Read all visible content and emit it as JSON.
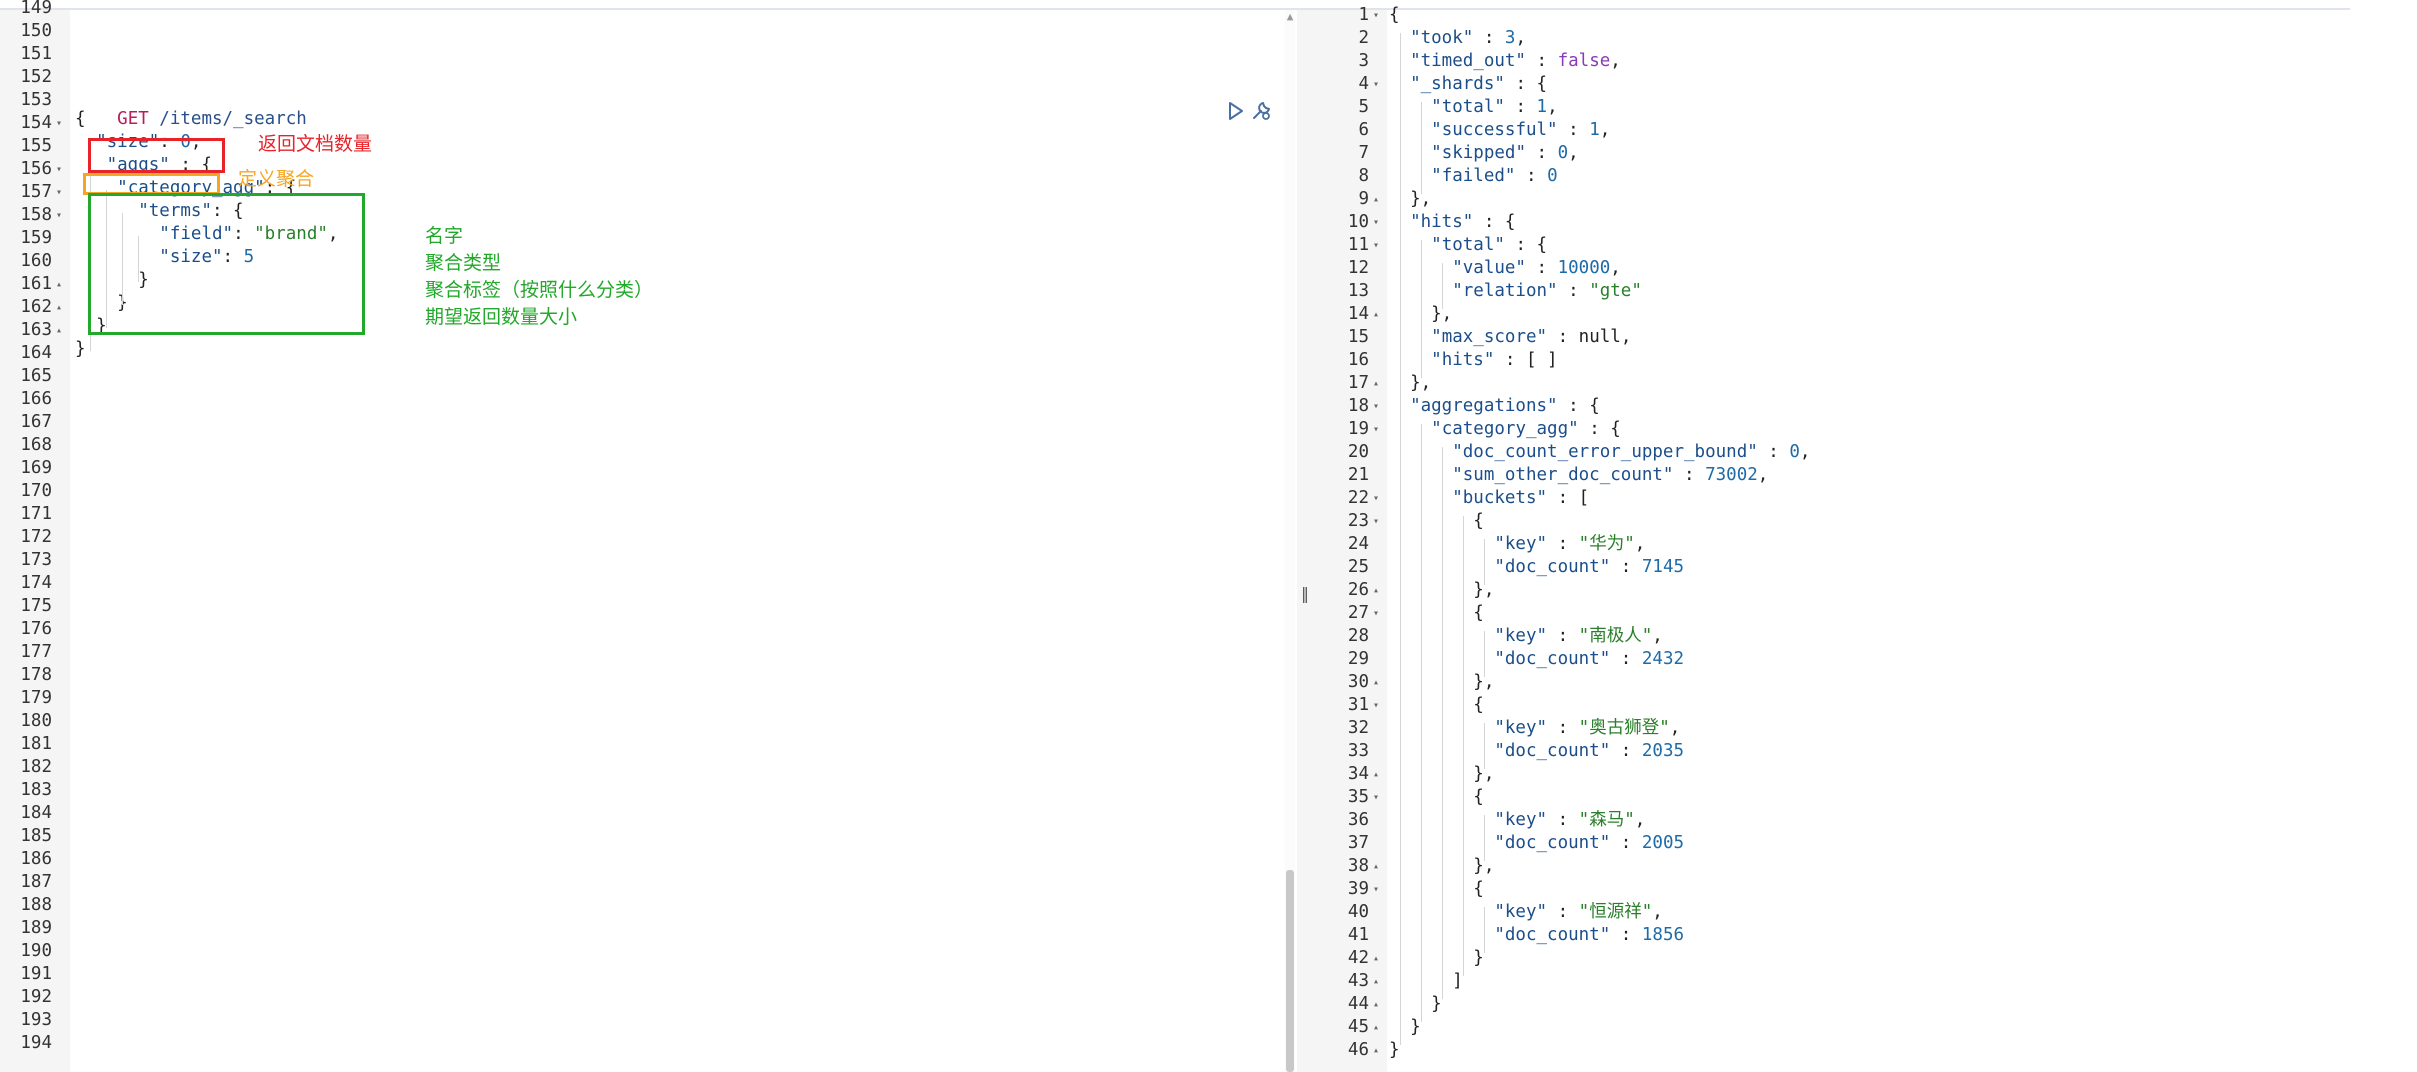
{
  "request_editor": {
    "method": "GET",
    "url": " /items/_search",
    "line_numbers": [
      "149",
      "150",
      "151",
      "152",
      "153",
      "154",
      "155",
      "156",
      "157",
      "158",
      "159",
      "160",
      "161",
      "162",
      "163",
      "164",
      "165",
      "166",
      "167",
      "168",
      "169",
      "170",
      "171",
      "172",
      "173",
      "174",
      "175",
      "176",
      "177",
      "178",
      "179",
      "180",
      "181",
      "182",
      "183",
      "184",
      "185",
      "186",
      "187",
      "188",
      "189",
      "190",
      "191",
      "192",
      "193",
      "194"
    ],
    "code": {
      "l154": "{",
      "l155_key": "\"size\"",
      "l155_rest": ": ",
      "l155_num": "0",
      "l155_end": ",",
      "l156_key": "\"aggs\"",
      "l156_rest": " : {",
      "l157_key": "\"category_agg\"",
      "l157_rest": ": {",
      "l158_key": "\"terms\"",
      "l158_rest": ": {",
      "l159_key": "\"field\"",
      "l159_rest": ": ",
      "l159_val": "\"brand\"",
      "l159_end": ",",
      "l160_key": "\"size\"",
      "l160_rest": ": ",
      "l160_num": "5",
      "l161": "}",
      "l162": "}",
      "l163": "}",
      "l164": "}"
    },
    "annotations": {
      "size_note": "返回文档数量",
      "aggs_note": "定义聚合",
      "name_note": "名字",
      "type_note": "聚合类型",
      "field_note": "聚合标签（按照什么分类）",
      "count_note": "期望返回数量大小"
    },
    "annotation_colors": {
      "red": "#e8232a",
      "orange": "#f5a623",
      "green": "#22a82a"
    },
    "icons": [
      "play-icon",
      "wrench-icon"
    ]
  },
  "response_panel": {
    "line_numbers": [
      "1",
      "2",
      "3",
      "4",
      "5",
      "6",
      "7",
      "8",
      "9",
      "10",
      "11",
      "12",
      "13",
      "14",
      "15",
      "16",
      "17",
      "18",
      "19",
      "20",
      "21",
      "22",
      "23",
      "24",
      "25",
      "26",
      "27",
      "28",
      "29",
      "30",
      "31",
      "32",
      "33",
      "34",
      "35",
      "36",
      "37",
      "38",
      "39",
      "40",
      "41",
      "42",
      "43",
      "44",
      "45",
      "46"
    ],
    "took": "3",
    "timed_out": "false",
    "shards": {
      "total": "1",
      "successful": "1",
      "skipped": "0",
      "failed": "0"
    },
    "hits": {
      "total_value": "10000",
      "total_relation": "\"gte\"",
      "max_score": "null",
      "hits": "[ ]"
    },
    "aggregation_name": "\"category_agg\"",
    "doc_count_error_upper_bound": "0",
    "sum_other_doc_count": "73002",
    "buckets": [
      {
        "key": "\"华为\"",
        "doc_count": "7145"
      },
      {
        "key": "\"南极人\"",
        "doc_count": "2432"
      },
      {
        "key": "\"奥古狮登\"",
        "doc_count": "2035"
      },
      {
        "key": "\"森马\"",
        "doc_count": "2005"
      },
      {
        "key": "\"恒源祥\"",
        "doc_count": "1856"
      }
    ]
  },
  "splitter_glyph": "‖",
  "scroll_up_glyph": "▲"
}
